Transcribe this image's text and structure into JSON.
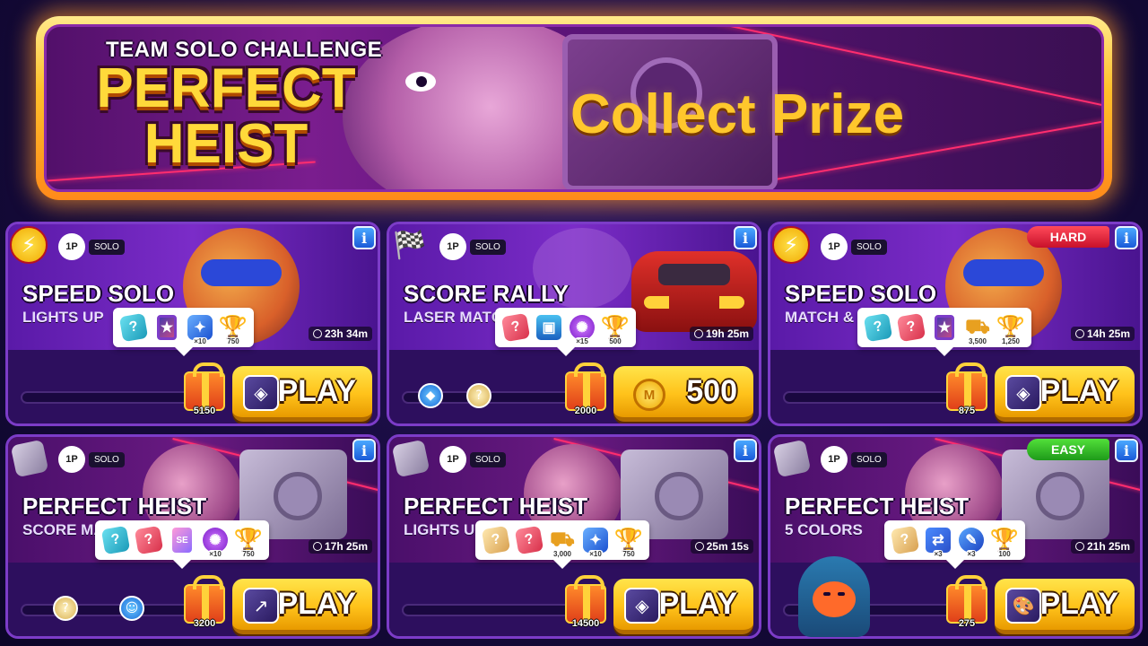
{
  "banner": {
    "subtitle": "TEAM SOLO CHALLENGE",
    "title_line1": "PERFECT",
    "title_line2": "HEIST",
    "cta": "Collect Prize"
  },
  "cards": [
    {
      "mode_icon": "lightning-icon",
      "players": "1P",
      "mode": "SOLO",
      "title": "SPEED SOLO",
      "subtitle": "LIGHTS UP",
      "timer": "23h 34m",
      "difficulty": "",
      "rewards": [
        {
          "icon": "mystery-cyan-icon",
          "qty": ""
        },
        {
          "icon": "sticker-card-icon",
          "qty": ""
        },
        {
          "icon": "blue-booster-icon",
          "qty": "×10"
        },
        {
          "icon": "trophy-icon",
          "qty": "750"
        }
      ],
      "gift_points": "5150",
      "button": "PLAY",
      "button_boost_icon": "booster-icon"
    },
    {
      "mode_icon": "checkered-flag-icon",
      "players": "1P",
      "mode": "SOLO",
      "title": "SCORE RALLY",
      "subtitle": "LASER MATCHE",
      "timer": "19h 25m",
      "difficulty": "",
      "rewards": [
        {
          "icon": "mystery-red-icon",
          "qty": ""
        },
        {
          "icon": "chest-icon",
          "qty": ""
        },
        {
          "icon": "purple-booster-icon",
          "qty": "×15"
        },
        {
          "icon": "trophy-icon",
          "qty": "500"
        }
      ],
      "gift_points": "2000",
      "button": "500",
      "button_boost_icon": "coin-icon"
    },
    {
      "mode_icon": "lightning-icon",
      "players": "1P",
      "mode": "SOLO",
      "title": "SPEED SOLO",
      "subtitle": "MATCH & H",
      "timer": "14h 25m",
      "difficulty": "HARD",
      "rewards": [
        {
          "icon": "mystery-cyan-icon",
          "qty": ""
        },
        {
          "icon": "mystery-red-icon",
          "qty": ""
        },
        {
          "icon": "sticker-card-icon",
          "qty": ""
        },
        {
          "icon": "cannon-icon",
          "qty": "3,500"
        },
        {
          "icon": "trophy-icon",
          "qty": "1,250"
        }
      ],
      "gift_points": "875",
      "button": "PLAY",
      "button_boost_icon": "booster-icon"
    },
    {
      "mode_icon": "safe-icon",
      "players": "1P",
      "mode": "SOLO",
      "title": "PERFECT HEIST",
      "subtitle": "SCORE MAR",
      "timer": "17h 25m",
      "difficulty": "",
      "rewards": [
        {
          "icon": "mystery-cyan-icon",
          "qty": ""
        },
        {
          "icon": "mystery-red-icon",
          "qty": ""
        },
        {
          "icon": "se-card-icon",
          "qty": ""
        },
        {
          "icon": "purple-booster-icon",
          "qty": "×10"
        },
        {
          "icon": "trophy-icon",
          "qty": "750"
        }
      ],
      "gift_points": "3200",
      "button": "PLAY",
      "button_boost_icon": "chart-booster-icon"
    },
    {
      "mode_icon": "safe-icon",
      "players": "1P",
      "mode": "SOLO",
      "title": "PERFECT HEIST",
      "subtitle": "LIGHTS UP",
      "timer": "25m 15s",
      "difficulty": "",
      "rewards": [
        {
          "icon": "mystery-gold-icon",
          "qty": ""
        },
        {
          "icon": "mystery-red-icon",
          "qty": ""
        },
        {
          "icon": "cannon-icon",
          "qty": "3,000"
        },
        {
          "icon": "blue-booster-icon",
          "qty": "×10"
        },
        {
          "icon": "trophy-icon",
          "qty": "750"
        }
      ],
      "gift_points": "14500",
      "button": "PLAY",
      "button_boost_icon": "booster-icon"
    },
    {
      "mode_icon": "safe-icon",
      "players": "1P",
      "mode": "SOLO",
      "title": "PERFECT HEIST",
      "subtitle": "5 COLORS",
      "timer": "21h 25m",
      "difficulty": "EASY",
      "rewards": [
        {
          "icon": "mystery-gold-icon",
          "qty": ""
        },
        {
          "icon": "duo-booster-icon",
          "qty": "×3"
        },
        {
          "icon": "wand-booster-icon",
          "qty": "×3"
        },
        {
          "icon": "trophy-icon",
          "qty": "100"
        }
      ],
      "gift_points": "275",
      "button": "PLAY",
      "button_boost_icon": "palette-booster-icon"
    }
  ]
}
